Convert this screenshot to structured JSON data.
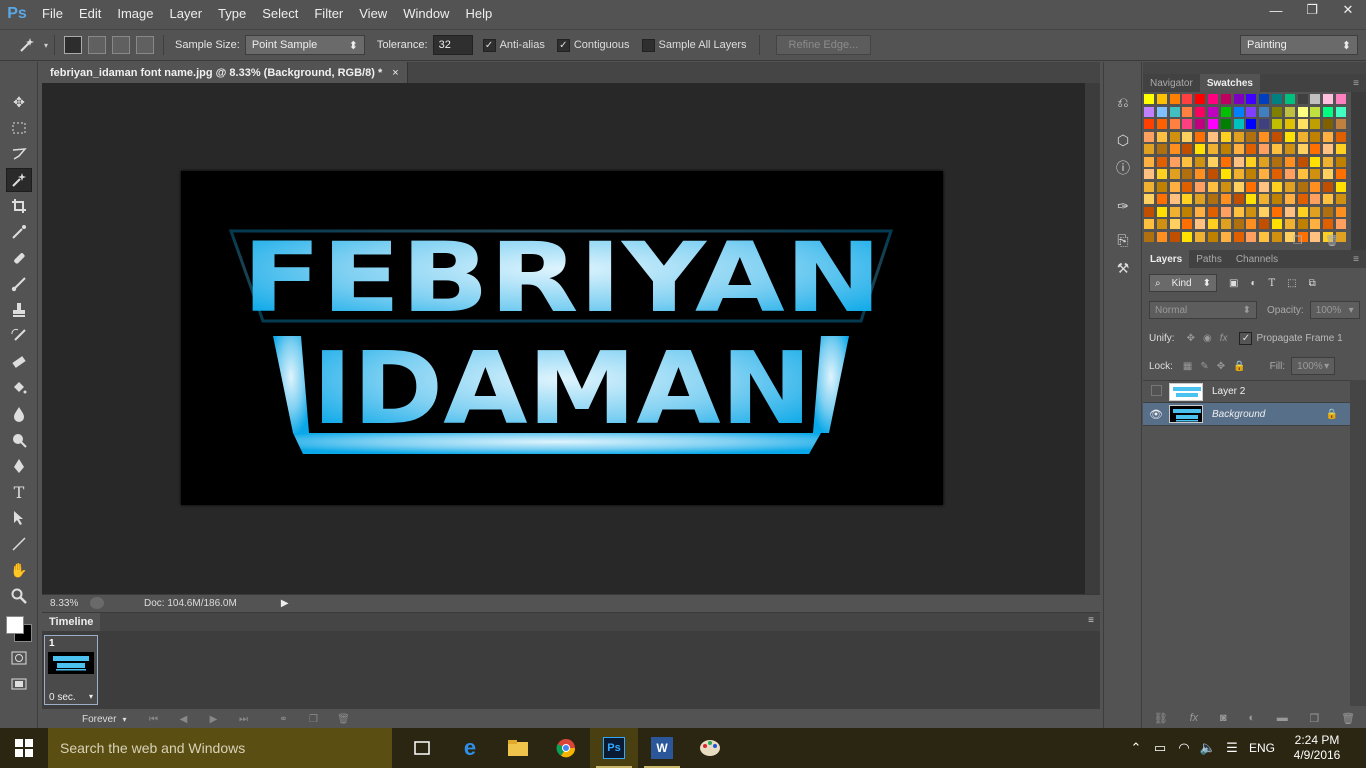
{
  "app": {
    "logo": "Ps",
    "menu": [
      "File",
      "Edit",
      "Image",
      "Layer",
      "Type",
      "Select",
      "Filter",
      "View",
      "Window",
      "Help"
    ],
    "window_controls": {
      "minimize": "—",
      "restore": "❐",
      "close": "✕"
    }
  },
  "options": {
    "sample_size_label": "Sample Size:",
    "sample_size_value": "Point Sample",
    "tolerance_label": "Tolerance:",
    "tolerance_value": "32",
    "antialias_label": "Anti-alias",
    "antialias_checked": true,
    "contiguous_label": "Contiguous",
    "contiguous_checked": true,
    "sample_all_layers_label": "Sample All Layers",
    "sample_all_layers_checked": false,
    "refine_edge_label": "Refine Edge...",
    "workspace_value": "Painting"
  },
  "document": {
    "tab_title": "febriyan_idaman font name.jpg @ 8.33% (Background, RGB/8) *",
    "tab_close": "×",
    "zoom": "8.33%",
    "doc_info": "Doc: 104.6M/186.0M"
  },
  "timeline": {
    "tab": "Timeline",
    "frame_number": "1",
    "frame_delay": "0 sec.",
    "loop": "Forever"
  },
  "panels": {
    "top_tabs": [
      "Navigator",
      "Swatches"
    ],
    "top_active": "Swatches",
    "layer_tabs": [
      "Layers",
      "Paths",
      "Channels"
    ],
    "layer_active": "Layers",
    "kind_filter": "Kind",
    "blend_mode": "Normal",
    "opacity_label": "Opacity:",
    "opacity_value": "100%",
    "unify_label": "Unify:",
    "propagate_label": "Propagate Frame 1",
    "lock_label": "Lock:",
    "fill_label": "Fill:",
    "fill_value": "100%",
    "layers": [
      {
        "name": "Layer 2",
        "visible": false,
        "selected": false
      },
      {
        "name": "Background",
        "visible": true,
        "selected": true
      }
    ]
  },
  "taskbar": {
    "search_placeholder": "Search the web and Windows",
    "language": "ENG",
    "time": "2:24 PM",
    "date": "4/9/2016"
  },
  "artwork": {
    "line1": "FEBRIYAN",
    "line2": "IDAMAN",
    "gradient_edge": "#0aa8e8",
    "gradient_center": "#d8f2fc"
  },
  "colors": {
    "accent": "#5aa7e6",
    "selected_layer": "#586f8a"
  }
}
